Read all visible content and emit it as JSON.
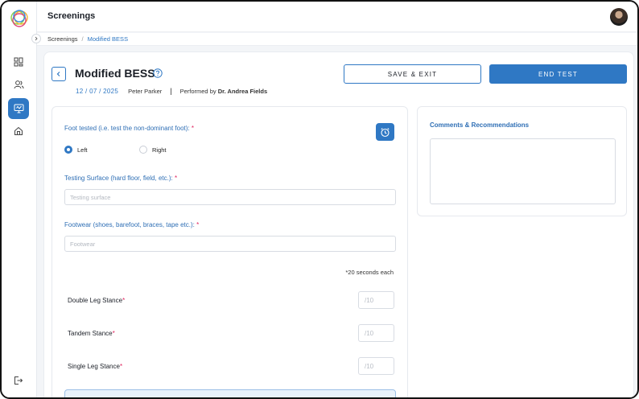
{
  "header": {
    "title": "Screenings"
  },
  "breadcrumb": {
    "items": [
      "Screenings",
      "Modified BESS"
    ],
    "separator": "/"
  },
  "sidebar": {
    "items": [
      {
        "icon": "dashboard-icon",
        "active": false
      },
      {
        "icon": "users-icon",
        "active": true
      },
      {
        "icon": "screening-icon",
        "active": true
      },
      {
        "icon": "home-icon",
        "active": false
      }
    ],
    "bottom_icon": "logout-icon"
  },
  "page": {
    "title": "Modified BESS",
    "date": "12 / 07 / 2025",
    "patient": "Peter Parker",
    "separator": "|",
    "performed_by_prefix": "Performed by",
    "performed_by_name": "Dr. Andrea Fields"
  },
  "actions": {
    "save_exit": "SAVE & EXIT",
    "end_test": "END TEST"
  },
  "form": {
    "foot_label": "Foot tested (i.e. test the non-dominant foot):",
    "foot_options": [
      "Left",
      "Right"
    ],
    "foot_selected": "Left",
    "surface_label": "Testing Surface (hard floor, field, etc.):",
    "surface_placeholder": "Testing surface",
    "footwear_label": "Footwear (shoes, barefoot, braces, tape etc.):",
    "footwear_placeholder": "Footwear",
    "required_mark": "*",
    "note": "*20 seconds each",
    "stances": [
      {
        "label": "Double Leg Stance",
        "placeholder": "/10"
      },
      {
        "label": "Tandem Stance",
        "placeholder": "/10"
      },
      {
        "label": "Single Leg Stance",
        "placeholder": "/10"
      }
    ]
  },
  "comments": {
    "title": "Comments & Recommendations",
    "value": ""
  },
  "colors": {
    "accent": "#2f78c4",
    "required": "#e0245e",
    "label": "#2f6fb5"
  }
}
